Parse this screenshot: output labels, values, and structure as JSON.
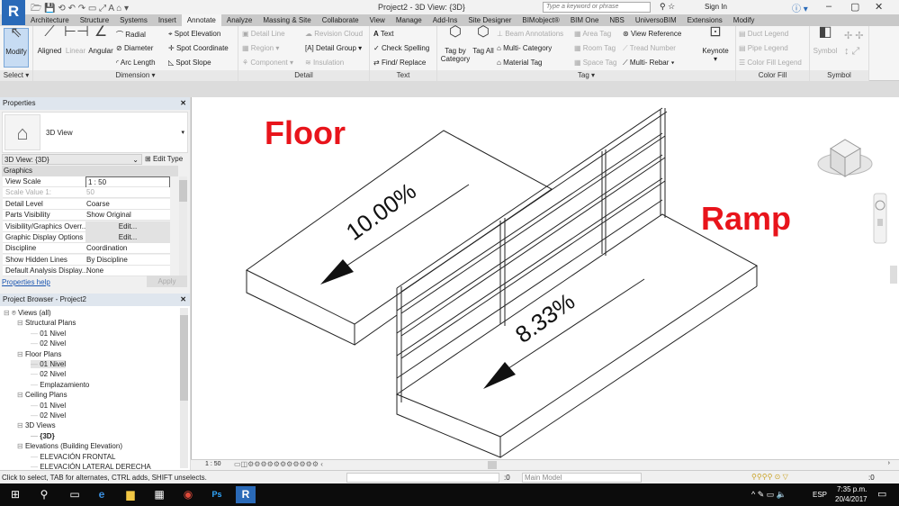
{
  "app": {
    "logo": "R",
    "title": "Project2 - 3D View: {3D}",
    "search_placeholder": "Type a keyword or phrase",
    "sign_in": "Sign In"
  },
  "tabs": [
    "Architecture",
    "Structure",
    "Systems",
    "Insert",
    "Annotate",
    "Analyze",
    "Massing & Site",
    "Collaborate",
    "View",
    "Manage",
    "Add-Ins",
    "Site Designer",
    "BIMobject®",
    "BIM One",
    "NBS",
    "UniversoBIM",
    "Extensions",
    "Modify"
  ],
  "active_tab": "Annotate",
  "ribbon": {
    "select": {
      "modify": "Modify",
      "label": "Select ▾"
    },
    "dimension": {
      "aligned": "Aligned",
      "linear": "Linear",
      "angular": "Angular",
      "radial": "Radial",
      "diameter": "Diameter",
      "arc_length": "Arc Length",
      "spot_elevation": "Spot Elevation",
      "spot_coordinate": "Spot Coordinate",
      "spot_slope": "Spot Slope",
      "label": "Dimension ▾"
    },
    "detail": {
      "detail_line": "Detail Line",
      "region": "Region ▾",
      "component": "Component ▾",
      "revision_cloud": "Revision Cloud",
      "detail_group": "Detail Group ▾",
      "insulation": "Insulation",
      "label": "Detail"
    },
    "text": {
      "text": "Text",
      "check_spelling": "Check Spelling",
      "find_replace": "Find/ Replace",
      "label": "Text"
    },
    "tag": {
      "tag_by_category": "Tag by Category",
      "tag_all": "Tag All",
      "beam_annotations": "Beam Annotations",
      "multi_category": "Multi- Category",
      "material_tag": "Material Tag",
      "area_tag": "Area Tag",
      "room_tag": "Room Tag",
      "space_tag": "Space Tag",
      "view_reference": "View Reference",
      "tread_number": "Tread Number",
      "multi_rebar": "Multi- Rebar ▾",
      "keynote": "Keynote",
      "label": "Tag ▾"
    },
    "color_fill": {
      "duct_legend": "Duct Legend",
      "pipe_legend": "Pipe Legend",
      "color_fill_legend": "Color Fill Legend",
      "label": "Color Fill"
    },
    "symbol": {
      "symbol": "Symbol",
      "label": "Symbol"
    }
  },
  "properties": {
    "title": "Properties",
    "type_name": "3D View",
    "selector": "3D View: {3D}",
    "edit_type": "Edit Type",
    "group": "Graphics",
    "rows": [
      {
        "k": "View Scale",
        "v": "1 : 50"
      },
      {
        "k": "Scale Value    1:",
        "v": "50"
      },
      {
        "k": "Detail Level",
        "v": "Coarse"
      },
      {
        "k": "Parts Visibility",
        "v": "Show Original"
      },
      {
        "k": "Visibility/Graphics Overr...",
        "v": "Edit..."
      },
      {
        "k": "Graphic Display Options",
        "v": "Edit..."
      },
      {
        "k": "Discipline",
        "v": "Coordination"
      },
      {
        "k": "Show Hidden Lines",
        "v": "By Discipline"
      },
      {
        "k": "Default Analysis Display...",
        "v": "None"
      }
    ],
    "help": "Properties help",
    "apply": "Apply"
  },
  "browser": {
    "title": "Project Browser - Project2",
    "items": [
      {
        "t": "Views (all)",
        "d": 0
      },
      {
        "t": "Structural Plans",
        "d": 1
      },
      {
        "t": "01 Nivel",
        "d": 2
      },
      {
        "t": "02 Nivel",
        "d": 2
      },
      {
        "t": "Floor Plans",
        "d": 1
      },
      {
        "t": "01 Nivel",
        "d": 2,
        "sel": true
      },
      {
        "t": "02 Nivel",
        "d": 2
      },
      {
        "t": "Emplazamiento",
        "d": 2
      },
      {
        "t": "Ceiling Plans",
        "d": 1
      },
      {
        "t": "01 Nivel",
        "d": 2
      },
      {
        "t": "02 Nivel",
        "d": 2
      },
      {
        "t": "3D Views",
        "d": 1
      },
      {
        "t": "{3D}",
        "d": 2,
        "bold": true
      },
      {
        "t": "Elevations (Building Elevation)",
        "d": 1
      },
      {
        "t": "ELEVACIÓN FRONTAL",
        "d": 2
      },
      {
        "t": "ELEVACIÓN LATERAL DERECHA",
        "d": 2
      }
    ]
  },
  "drawing": {
    "floor_label": "Floor",
    "ramp_label": "Ramp",
    "floor_slope": "10.00%",
    "ramp_slope": "8.33%",
    "label_color": "#e8141b"
  },
  "viewbar": {
    "scale": "1 : 50"
  },
  "status": {
    "hint": "Click to select, TAB for alternates, CTRL adds, SHIFT unselects.",
    "workset_count": ":0",
    "model": "Main Model",
    "filter_count": ":0"
  },
  "taskbar": {
    "time": "7:35 p.m.",
    "date": "20/4/2017",
    "lang": "ESP"
  }
}
